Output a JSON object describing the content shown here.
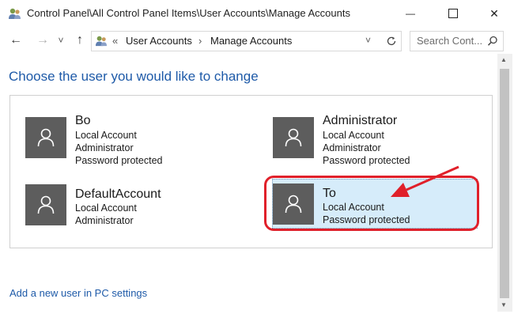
{
  "window": {
    "title": "Control Panel\\All Control Panel Items\\User Accounts\\Manage Accounts",
    "minimize_glyph": "—",
    "maximize_glyph": "☐",
    "close_glyph": "✕"
  },
  "nav": {
    "back_glyph": "←",
    "forward_glyph": "→",
    "dropdown_glyph": "˅",
    "up_glyph": "↑",
    "breadcrumb_overflow": "«",
    "breadcrumb": [
      "User Accounts",
      "Manage Accounts"
    ],
    "separator": "›",
    "address_dropdown_glyph": "˅",
    "search_placeholder": "Search Cont..."
  },
  "main": {
    "heading": "Choose the user you would like to change",
    "accounts": [
      {
        "name": "Bo",
        "lines": [
          "Local Account",
          "Administrator",
          "Password protected"
        ],
        "selected": false
      },
      {
        "name": "Administrator",
        "lines": [
          "Local Account",
          "Administrator",
          "Password protected"
        ],
        "selected": false
      },
      {
        "name": "DefaultAccount",
        "lines": [
          "Local Account",
          "Administrator"
        ],
        "selected": false
      },
      {
        "name": "To",
        "lines": [
          "Local Account",
          "Password protected"
        ],
        "selected": true
      }
    ],
    "add_user_link": "Add a new user in PC settings"
  },
  "colors": {
    "link": "#1e5aa8",
    "avatar_bg": "#5d5d5d",
    "selected_bg": "#d6ecfa",
    "annotation_red": "#e0202a"
  },
  "icons": {
    "app": "control-panel-users-icon",
    "avatar": "user-silhouette-icon",
    "refresh": "refresh-icon",
    "search": "search-icon"
  }
}
